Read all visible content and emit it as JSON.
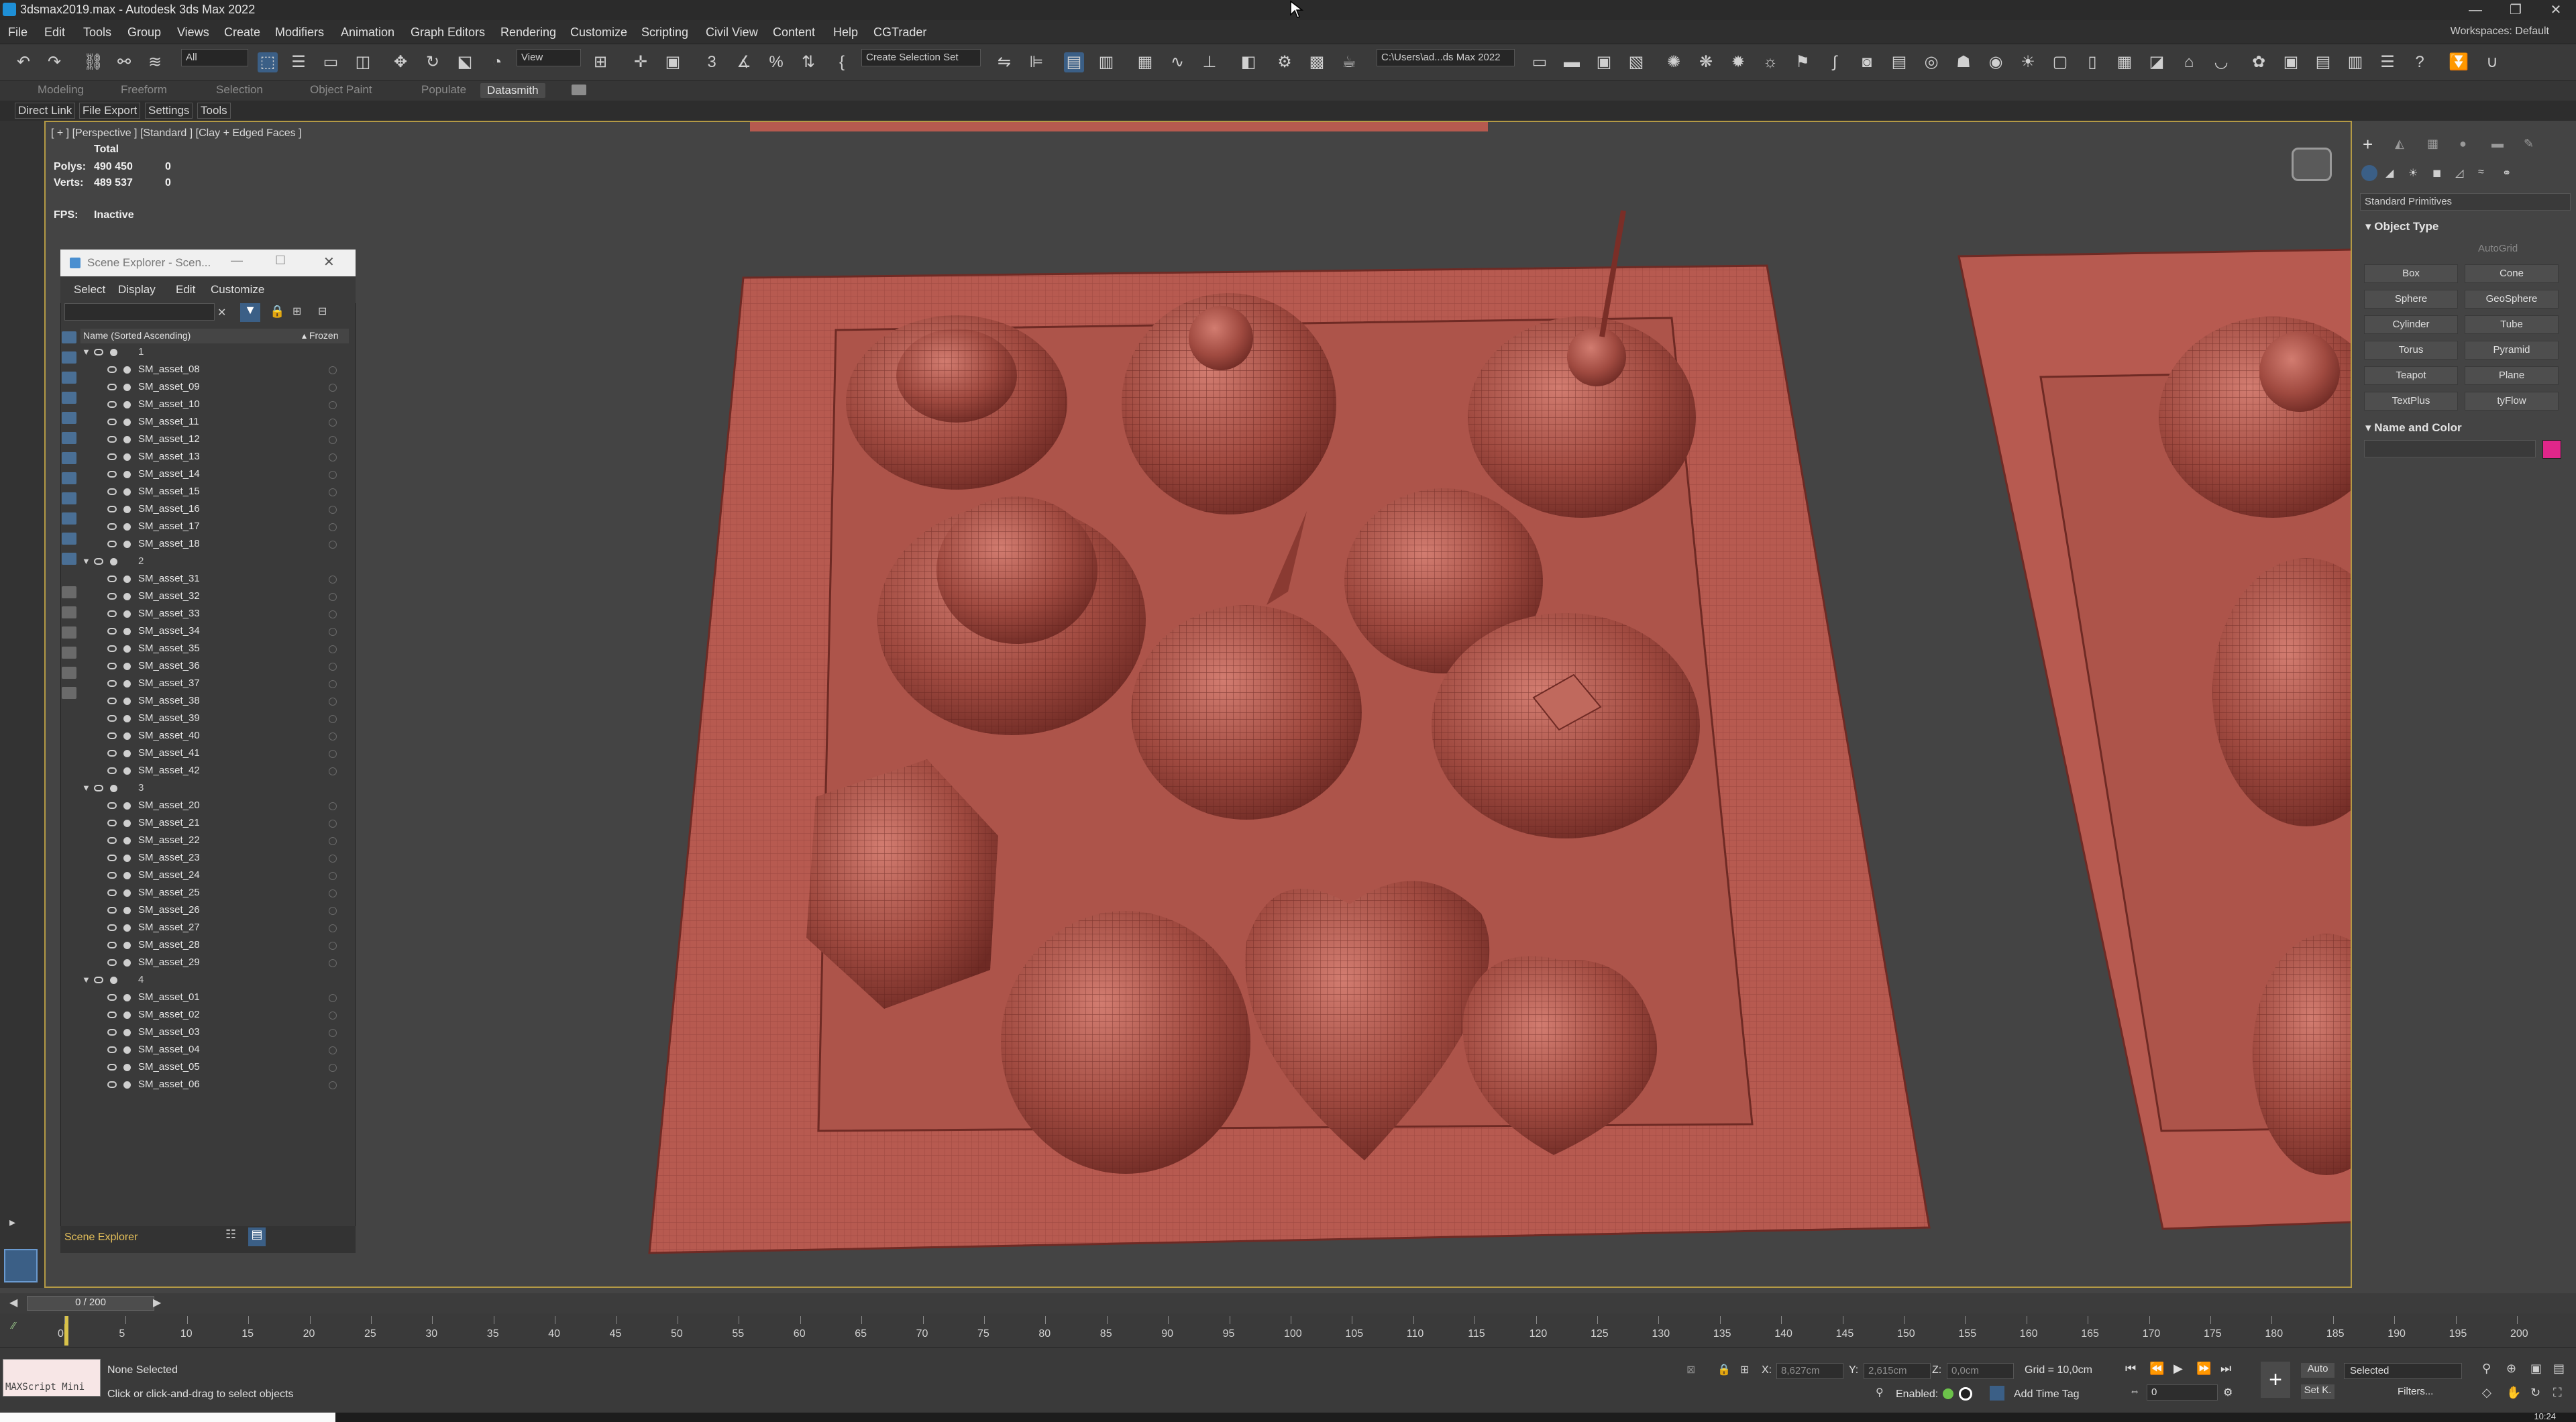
{
  "window": {
    "title": "3dsmax2019.max - Autodesk 3ds Max 2022",
    "minimize": "—",
    "maximize": "❐",
    "close": "✕"
  },
  "menu": [
    "File",
    "Edit",
    "Tools",
    "Group",
    "Views",
    "Create",
    "Modifiers",
    "Animation",
    "Graph Editors",
    "Rendering",
    "Customize",
    "Scripting",
    "Civil View",
    "Content",
    "Help",
    "CGTrader"
  ],
  "workspaces": "Workspaces: Default",
  "toolbar": {
    "selection_filter": "All",
    "ref_coord": "View",
    "selection_set": "Create Selection Set",
    "project_path": "C:\\Users\\ad...ds Max 2022"
  },
  "ribbon_tabs": [
    "Modeling",
    "Freeform",
    "Selection",
    "Object Paint",
    "Populate",
    "Datasmith"
  ],
  "plugin_tabs": [
    "Direct Link",
    "File Export",
    "Settings",
    "Tools"
  ],
  "viewport": {
    "label": "[ + ] [Perspective ] [Standard ] [Clay + Edged Faces ]",
    "stats_total": "Total",
    "polys_label": "Polys:",
    "polys_value": "490 450",
    "polys_sel": "0",
    "verts_label": "Verts:",
    "verts_value": "489 537",
    "verts_sel": "0",
    "fps_label": "FPS:",
    "fps_value": "Inactive"
  },
  "scene_explorer": {
    "title": "Scene Explorer - Scen...",
    "menu": [
      "Select",
      "Display",
      "Edit",
      "Customize"
    ],
    "col_name": "Name (Sorted Ascending)",
    "col_frozen": "▴ Frozen",
    "footer": "Scene Explorer",
    "groups": [
      {
        "name": "1",
        "items": [
          "SM_asset_08",
          "SM_asset_09",
          "SM_asset_10",
          "SM_asset_11",
          "SM_asset_12",
          "SM_asset_13",
          "SM_asset_14",
          "SM_asset_15",
          "SM_asset_16",
          "SM_asset_17",
          "SM_asset_18"
        ]
      },
      {
        "name": "2",
        "items": [
          "SM_asset_31",
          "SM_asset_32",
          "SM_asset_33",
          "SM_asset_34",
          "SM_asset_35",
          "SM_asset_36",
          "SM_asset_37",
          "SM_asset_38",
          "SM_asset_39",
          "SM_asset_40",
          "SM_asset_41",
          "SM_asset_42"
        ]
      },
      {
        "name": "3",
        "items": [
          "SM_asset_20",
          "SM_asset_21",
          "SM_asset_22",
          "SM_asset_23",
          "SM_asset_24",
          "SM_asset_25",
          "SM_asset_26",
          "SM_asset_27",
          "SM_asset_28",
          "SM_asset_29"
        ]
      },
      {
        "name": "4",
        "items": [
          "SM_asset_01",
          "SM_asset_02",
          "SM_asset_03",
          "SM_asset_04",
          "SM_asset_05",
          "SM_asset_06"
        ]
      }
    ]
  },
  "command_panel": {
    "category": "Standard Primitives",
    "object_type": "Object Type",
    "autogrid": "AutoGrid",
    "buttons": [
      "Box",
      "Cone",
      "Sphere",
      "GeoSphere",
      "Cylinder",
      "Tube",
      "Torus",
      "Pyramid",
      "Teapot",
      "Plane",
      "TextPlus",
      "tyFlow"
    ],
    "name_and_color": "Name and Color",
    "swatch_color": "#e0268a"
  },
  "timeline": {
    "frame_display": "0 / 200",
    "ticks": [
      "0",
      "5",
      "10",
      "15",
      "20",
      "25",
      "30",
      "35",
      "40",
      "45",
      "50",
      "55",
      "60",
      "65",
      "70",
      "75",
      "80",
      "85",
      "90",
      "95",
      "100",
      "105",
      "110",
      "115",
      "120",
      "125",
      "130",
      "135",
      "140",
      "145",
      "150",
      "155",
      "160",
      "165",
      "170",
      "175",
      "180",
      "185",
      "190",
      "195",
      "200"
    ]
  },
  "status": {
    "maxscript": "MAXScript Mini",
    "selection": "None Selected",
    "prompt": "Click or click-and-drag to select objects",
    "x_label": "X:",
    "x_value": "8,627cm",
    "y_label": "Y:",
    "y_value": "2,615cm",
    "z_label": "Z:",
    "z_value": "0,0cm",
    "grid": "Grid = 10,0cm",
    "enabled_label": "Enabled:",
    "add_time_tag": "Add Time Tag",
    "auto": "Auto",
    "selected": "Selected",
    "set_key": "Set K.",
    "filters": "Filters...",
    "frame_field": "0",
    "clock": "10:24"
  },
  "colors": {
    "accent_blue": "#3b5f86",
    "viewport_border": "#b49a45",
    "clay": "#b85c52"
  }
}
